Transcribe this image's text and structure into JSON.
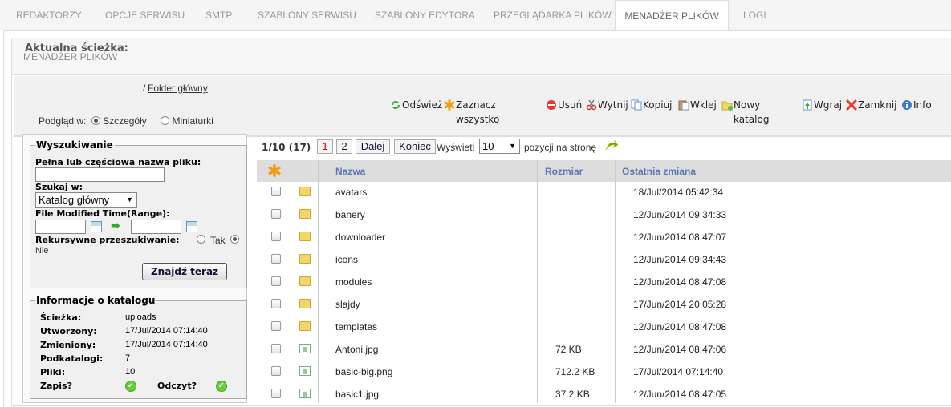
{
  "tabs": [
    {
      "label": "REDAKTORZY",
      "active": false
    },
    {
      "label": "OPCJE SERWISU",
      "active": false
    },
    {
      "label": "SMTP",
      "active": false
    },
    {
      "label": "SZABLONY SERWISU",
      "active": false
    },
    {
      "label": "SZABLONY EDYTORA",
      "active": false
    },
    {
      "label": "PRZEGLĄDARKA PLIKÓW",
      "active": false
    },
    {
      "label": "MENADŻER PLIKÓW",
      "active": true
    },
    {
      "label": "LOGI",
      "active": false
    }
  ],
  "panel": {
    "title": "MENADŻER PLIKÓW"
  },
  "path": {
    "label": "Aktualna ścieżka:",
    "prefix": "/",
    "link": "Folder główny"
  },
  "toolbar": {
    "refresh": "Odśwież",
    "select_all": "Zaznacz wszystko",
    "delete": "Usuń",
    "cut": "Wytnij",
    "copy": "Kopiuj",
    "paste": "Wklej",
    "new_folder": "Nowy katalog",
    "upload": "Wgraj",
    "close": "Zamknij",
    "info": "Info"
  },
  "view": {
    "label": "Podgląd w:",
    "details": "Szczegóły",
    "thumbnails": "Miniaturki",
    "selected": "details"
  },
  "search": {
    "legend": "Wyszukiwanie",
    "name_label": "Pełna lub częściowa nazwa pliku:",
    "name_value": "",
    "search_in_label": "Szukaj w:",
    "search_in_value": "Katalog główny",
    "modified_label": "File Modified Time(Range):",
    "recursive_label": "Rekursywne przeszukiwanie:",
    "yes_label": "Tak",
    "no_label": "Nie",
    "recursive_selected": "no",
    "submit": "Znajdź teraz"
  },
  "folder_info": {
    "legend": "Informacje o katalogu",
    "path_label": "Ścieżka:",
    "path_value": "uploads",
    "created_label": "Utworzony:",
    "created_value": "17/Jul/2014 07:14:40",
    "modified_label": "Zmieniony:",
    "modified_value": "17/Jul/2014 07:14:40",
    "subfolders_label": "Podkatalogi:",
    "subfolders_value": "7",
    "files_label": "Pliki:",
    "files_value": "10",
    "write_label": "Zapis?",
    "read_label": "Odczyt?",
    "write_ok": true,
    "read_ok": true
  },
  "pager": {
    "info": "1/10 (17)",
    "pages": [
      "1",
      "2"
    ],
    "current_page": "1",
    "next": "Dalej",
    "last": "Koniec",
    "show_label": "Wyświetl",
    "per_page": "10",
    "per_page_suffix": "pozycji na stronę"
  },
  "table": {
    "headers": {
      "name": "Nazwa",
      "size": "Rozmiar",
      "modified": "Ostatnia zmiana"
    },
    "rows": [
      {
        "type": "folder",
        "name": "avatars",
        "size": "",
        "modified": "18/Jul/2014 05:42:34"
      },
      {
        "type": "folder",
        "name": "banery",
        "size": "",
        "modified": "12/Jun/2014 09:34:33"
      },
      {
        "type": "folder",
        "name": "downloader",
        "size": "",
        "modified": "12/Jun/2014 08:47:07"
      },
      {
        "type": "folder",
        "name": "icons",
        "size": "",
        "modified": "12/Jun/2014 09:34:43"
      },
      {
        "type": "folder",
        "name": "modules",
        "size": "",
        "modified": "12/Jun/2014 08:47:08"
      },
      {
        "type": "folder",
        "name": "slajdy",
        "size": "",
        "modified": "17/Jun/2014 20:05:28"
      },
      {
        "type": "folder",
        "name": "templates",
        "size": "",
        "modified": "12/Jun/2014 08:47:08"
      },
      {
        "type": "image",
        "name": "Antoni.jpg",
        "size": "72 KB",
        "modified": "12/Jun/2014 08:47:06"
      },
      {
        "type": "image",
        "name": "basic-big.png",
        "size": "712.2 KB",
        "modified": "17/Jul/2014 07:14:40"
      },
      {
        "type": "image",
        "name": "basic1.jpg",
        "size": "37.2 KB",
        "modified": "12/Jun/2014 08:47:05"
      }
    ]
  },
  "colors": {
    "header_link": "#5b7ab0",
    "active_page": "#cc0000",
    "ok_green": "#66cc44"
  }
}
